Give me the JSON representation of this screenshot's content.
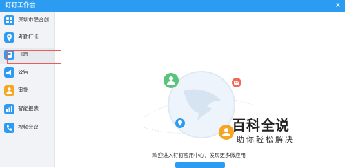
{
  "window": {
    "title": "钉钉工作台",
    "close_glyph": "×"
  },
  "sidebar": {
    "items": [
      {
        "label": "深圳市联合创...",
        "icon": "org-grid-icon",
        "color": "#2b9cf2"
      },
      {
        "label": "考勤打卡",
        "icon": "location-pin-icon",
        "color": "#2b9cf2"
      },
      {
        "label": "日志",
        "icon": "notebook-icon",
        "color": "#2b9cf2"
      },
      {
        "label": "公告",
        "icon": "megaphone-icon",
        "color": "#2b9cf2"
      },
      {
        "label": "审批",
        "icon": "person-badge-icon",
        "color": "#f5a623"
      },
      {
        "label": "智能报表",
        "icon": "bar-chart-icon",
        "color": "#2b9cf2"
      },
      {
        "label": "视频会议",
        "icon": "phone-icon",
        "color": "#2b9cf2"
      }
    ]
  },
  "main": {
    "welcome_text": "欢迎进入钉钉应用中心，发现更多微应用"
  },
  "watermark": {
    "title": "百科全说",
    "subtitle": "助你轻松解决"
  },
  "colors": {
    "accent": "#2b9cf2",
    "highlight_border": "#f05a5a",
    "green": "#5ac47a",
    "red": "#f06a5a",
    "orange": "#f5a623"
  }
}
